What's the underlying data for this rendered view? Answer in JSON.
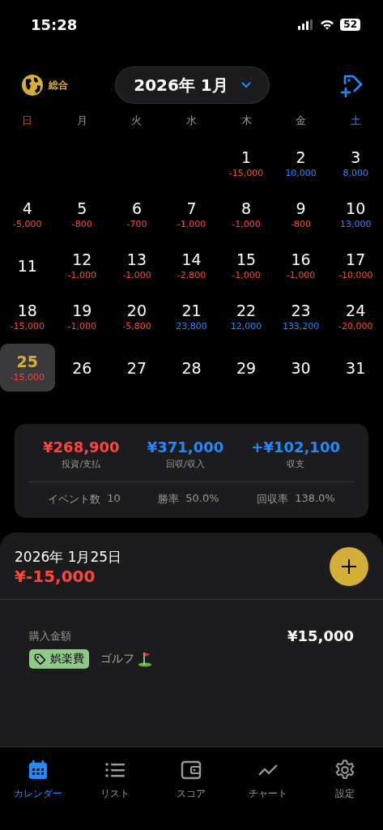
{
  "status_bar": {
    "time": "15:28",
    "battery": "52"
  },
  "header": {
    "scope_label": "総合",
    "month": "2026年 1月"
  },
  "weekdays": [
    {
      "label": "日",
      "kind": "sunday"
    },
    {
      "label": "月",
      "kind": "weekday"
    },
    {
      "label": "火",
      "kind": "weekday"
    },
    {
      "label": "水",
      "kind": "weekday"
    },
    {
      "label": "木",
      "kind": "weekday"
    },
    {
      "label": "金",
      "kind": "weekday"
    },
    {
      "label": "土",
      "kind": "saturday"
    }
  ],
  "days": [
    {
      "kind": "blank"
    },
    {
      "kind": "blank"
    },
    {
      "kind": "blank"
    },
    {
      "kind": "blank"
    },
    {
      "kind": "day",
      "day": "1",
      "amount": "-15,000",
      "color": "#ff453a",
      "selected": false
    },
    {
      "kind": "day",
      "day": "2",
      "amount": "10,000",
      "color": "#1e8bff",
      "selected": false
    },
    {
      "kind": "day",
      "day": "3",
      "amount": "8,000",
      "color": "#1e8bff",
      "selected": false
    },
    {
      "kind": "day",
      "day": "4",
      "amount": "-5,000",
      "color": "#ff453a",
      "selected": false
    },
    {
      "kind": "day",
      "day": "5",
      "amount": "-800",
      "color": "#ff453a",
      "selected": false
    },
    {
      "kind": "day",
      "day": "6",
      "amount": "-700",
      "color": "#ff453a",
      "selected": false
    },
    {
      "kind": "day",
      "day": "7",
      "amount": "-1,000",
      "color": "#ff453a",
      "selected": false
    },
    {
      "kind": "day",
      "day": "8",
      "amount": "-1,000",
      "color": "#ff453a",
      "selected": false
    },
    {
      "kind": "day",
      "day": "9",
      "amount": "-800",
      "color": "#ff453a",
      "selected": false
    },
    {
      "kind": "day",
      "day": "10",
      "amount": "13,000",
      "color": "#1e8bff",
      "selected": false
    },
    {
      "kind": "day",
      "day": "11",
      "selected": false
    },
    {
      "kind": "day",
      "day": "12",
      "amount": "-1,000",
      "color": "#ff453a",
      "selected": false
    },
    {
      "kind": "day",
      "day": "13",
      "amount": "-1,000",
      "color": "#ff453a",
      "selected": false
    },
    {
      "kind": "day",
      "day": "14",
      "amount": "-2,800",
      "color": "#ff453a",
      "selected": false
    },
    {
      "kind": "day",
      "day": "15",
      "amount": "-1,000",
      "color": "#ff453a",
      "selected": false
    },
    {
      "kind": "day",
      "day": "16",
      "amount": "-1,000",
      "color": "#ff453a",
      "selected": false
    },
    {
      "kind": "day",
      "day": "17",
      "amount": "-10,000",
      "color": "#ff453a",
      "selected": false
    },
    {
      "kind": "day",
      "day": "18",
      "amount": "-15,000",
      "color": "#ff453a",
      "selected": false
    },
    {
      "kind": "day",
      "day": "19",
      "amount": "-1,000",
      "color": "#ff453a",
      "selected": false
    },
    {
      "kind": "day",
      "day": "20",
      "amount": "-5,800",
      "color": "#ff453a",
      "selected": false
    },
    {
      "kind": "day",
      "day": "21",
      "amount": "23,800",
      "color": "#1e8bff",
      "selected": false
    },
    {
      "kind": "day",
      "day": "22",
      "amount": "12,000",
      "color": "#1e8bff",
      "selected": false
    },
    {
      "kind": "day",
      "day": "23",
      "amount": "133,200",
      "color": "#1e8bff",
      "selected": false
    },
    {
      "kind": "day",
      "day": "24",
      "amount": "-20,000",
      "color": "#ff453a",
      "selected": false
    },
    {
      "kind": "day",
      "day": "25",
      "amount": "-15,000",
      "color": "#ff453a",
      "selected": true
    },
    {
      "kind": "day",
      "day": "26",
      "selected": false
    },
    {
      "kind": "day",
      "day": "27",
      "selected": false
    },
    {
      "kind": "day",
      "day": "28",
      "selected": false
    },
    {
      "kind": "day",
      "day": "29",
      "selected": false
    },
    {
      "kind": "day",
      "day": "30",
      "selected": false
    },
    {
      "kind": "day",
      "day": "31",
      "selected": false
    }
  ],
  "summary": {
    "totals": [
      {
        "value": "¥268,900",
        "label": "投資/支払",
        "color": "#ff453a"
      },
      {
        "value": "¥371,000",
        "label": "回収/収入",
        "color": "#1e8bff"
      },
      {
        "value": "+¥102,100",
        "label": "収支",
        "color": "#1e8bff"
      }
    ],
    "stats": [
      {
        "label": "イベント数",
        "value": "10"
      },
      {
        "label": "勝率",
        "value": "50.0%"
      },
      {
        "label": "回収率",
        "value": "138.0%"
      }
    ]
  },
  "detail": {
    "date": "2026年 1月25日",
    "total": "¥-15,000",
    "entries": [
      {
        "label": "購入金額",
        "amount": "¥15,000",
        "category": "娯楽費",
        "memo": "ゴルフ"
      }
    ]
  },
  "tab_bar": [
    {
      "label": "カレンダー",
      "selected": true
    },
    {
      "label": "リスト",
      "selected": false
    },
    {
      "label": "スコア",
      "selected": false
    },
    {
      "label": "チャート",
      "selected": false
    },
    {
      "label": "設定",
      "selected": false
    }
  ]
}
